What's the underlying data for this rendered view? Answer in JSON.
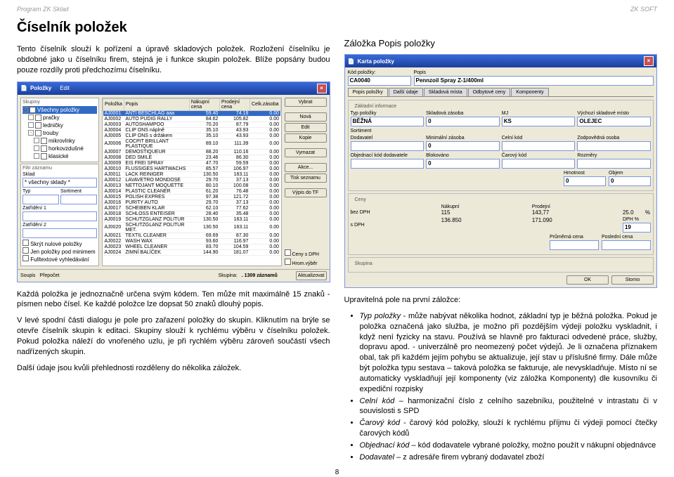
{
  "header": {
    "left": "Program ZK Sklad",
    "right": "ZK SOFT"
  },
  "left": {
    "title": "Číselník položek",
    "para1": "Tento číselník slouží k pořízení a úpravě skladových položek. Rozložení číselníku je obdobné jako u číselníku firem, stejná je i funkce skupin položek. Blíže popsány budou pouze rozdíly proti předchozímu číselníku.",
    "para2": "Každá položka je jednoznačně určena svým kódem. Ten může mít maximálně 15 znaků - písmen nebo čísel. Ke každé položce lze dopsat 50 znaků dlouhý popis.",
    "para3": "V levé spodní části dialogu je pole pro zařazení položky do skupin. Kliknutím na brýle se otevře číselník skupin k editaci. Skupiny slouží k rychlému výběru v číselníku položek. Pokud položka náleží do vnořeného uzlu, je při rychlém výběru zároveň součástí všech nadřízených skupin.",
    "para4": "Další údaje jsou kvůli přehlednosti rozděleny do několika záložek."
  },
  "right": {
    "subtitle": "Záložka Popis položky",
    "intro": "Upravitelná pole na první záložce:",
    "items": [
      "Typ položky - může nabývat několika hodnot, základní typ je běžná položka. Pokud je položka označená jako služba, je možno při pozdějším výdeji položku vyskladnit, i když není fyzicky na stavu. Používá se hlavně pro fakturaci odvedené práce, služby, dopravu apod. - univerzálně pro neomezený počet výdejů. Je li označena příznakem obal, tak při každém jejím pohybu se aktualizuje, její stav u příslušné firmy. Dále může být položka typu sestava – taková položka se fakturuje, ale nevyskladňuje. Místo ní se automaticky vyskladňují její komponenty (viz záložka Komponenty) dle kusovníku či expediční rozpisky",
      "Celní kód – harmonizační číslo z celního sazebníku, použitelné v intrastatu či v souvislosti s SPD",
      "Čarový kód - čarový kód položky, slouží k rychlému příjmu či výdeji pomocí čtečky čarových kódů",
      "Objednací kód – kód dodavatele vybrané položky, možno použít v nákupní objednávce",
      "Dodavatel – z adresáře firem vybraný dodavatel zboží"
    ]
  },
  "scr1": {
    "title": "Položky",
    "tree_head": "Skupiny",
    "tree": [
      "Všechny položky",
      "pračky",
      "ledničky",
      "trouby",
      "mikrovlnky",
      "horkovzdušné",
      "klasické"
    ],
    "filter_head": "Filtr záznamu",
    "filter_sklad_lbl": "Sklad",
    "filter_sklad_val": "* všechny sklady *",
    "f_typ": "Typ",
    "f_sort": "Sortiment",
    "f_z1": "Zatřídění 1",
    "f_z2": "Zatřídění 2",
    "chk1": "Skrýt nulové položky",
    "chk2": "Jen položky pod minimem",
    "chk3": "Fulltextové vyhledávání",
    "cols": [
      "Položka",
      "Popis",
      "Nákupní cena",
      "Prodejní cena",
      "Celk.zásoba"
    ],
    "rows": [
      [
        "AJ0001",
        "ANTI BESCHLAG aaa",
        "59.40",
        "74.18",
        "0.00"
      ],
      [
        "AJ0002",
        "AUTO PUDIG RALLY",
        "84.62",
        "105.82",
        "0.00"
      ],
      [
        "AJ0003",
        "AUTOSHAMPOO",
        "70.20",
        "87.79",
        "0.00"
      ],
      [
        "AJ0004",
        "CLIP ONS náplně",
        "35.10",
        "43.93",
        "0.00"
      ],
      [
        "AJ0005",
        "CLIP ONS s držákem",
        "35.10",
        "43.93",
        "0.00"
      ],
      [
        "AJ0006",
        "COCPIT BRILLANT PLASTIQUE",
        "89.10",
        "111.39",
        "0.00"
      ],
      [
        "AJ0007",
        "DEMOSTIQUEUR",
        "88.20",
        "110.16",
        "0.00"
      ],
      [
        "AJ0008",
        "DED SMILE",
        "23.46",
        "86.30",
        "0.00"
      ],
      [
        "AJ0009",
        "EIS FREI SPRAY",
        "47.70",
        "59.59",
        "0.00"
      ],
      [
        "AJ0010",
        "FLUSSIGES HARTWACHS",
        "85.57",
        "106.97",
        "0.00"
      ],
      [
        "AJ0011",
        "LACK REINIGER",
        "130.50",
        "163.11",
        "0.00"
      ],
      [
        "AJ0012",
        "LAVAVETRO MONDOSE",
        "29.70",
        "37.13",
        "0.00"
      ],
      [
        "AJ0013",
        "NETTOJANT MOQUETTE",
        "80.10",
        "100.08",
        "0.00"
      ],
      [
        "AJ0014",
        "PLASTIC CLEANER",
        "61.20",
        "76.48",
        "0.00"
      ],
      [
        "AJ0015",
        "POLISH EXPRES",
        "97.38",
        "121.72",
        "0.00"
      ],
      [
        "AJ0016",
        "PURITY AUTO",
        "29.70",
        "37.13",
        "0.00"
      ],
      [
        "AJ0017",
        "SCHEIBEN KLAR",
        "62.10",
        "77.62",
        "0.00"
      ],
      [
        "AJ0018",
        "SCHLOSS ENTEISER",
        "28.40",
        "35.48",
        "0.00"
      ],
      [
        "AJ0019",
        "SCHUTZGLANZ POLITUR",
        "130.50",
        "163.11",
        "0.00"
      ],
      [
        "AJ0020",
        "SCHUTZGLANZ POLITUR MET.",
        "130.50",
        "163.11",
        "0.00"
      ],
      [
        "AJ0021",
        "TEXTIL CLEANER",
        "69.69",
        "87.30",
        "0.00"
      ],
      [
        "AJ0022",
        "WASH WAX",
        "93.60",
        "116.97",
        "0.00"
      ],
      [
        "AJ0023",
        "WHEEL CLEANER",
        "83.70",
        "104.59",
        "0.00"
      ],
      [
        "AJ0024",
        "ZIMNÍ BALÍČEK",
        "144.90",
        "181.07",
        "0.00"
      ]
    ],
    "btns": [
      "Vybrat",
      "Nová",
      "Edit",
      "Kopie",
      "Vymazat",
      "Akce...",
      "Tisk seznamu",
      "Výpis do TF"
    ],
    "chkR1": "Ceny s DPH",
    "chkR2": "Hrom.výběr",
    "btnAkt": "Aktualizovat",
    "status": {
      "s1": "Soupis",
      "s2": "Přepočet",
      "s3_lbl": "Skupina:",
      "s3_val": ".   1309 záznamů",
      "menu": "Edit"
    }
  },
  "scr2": {
    "title": "Karta položky",
    "kod_lbl": "Kód položky:",
    "kod_val": "CA0040",
    "popis_lbl": "Popis",
    "popis_val": "Pennzoil Spray Z-1/400ml",
    "tabs": [
      "Popis položky",
      "Další údaje",
      "Skladová místa",
      "Odbytové ceny",
      "Komponenty"
    ],
    "grp1": "Základní informace",
    "typ_lbl": "Typ položky",
    "typ_val": "BĚŽNÁ",
    "zas_lbl": "Skladová zásoba",
    "zas_val": "0",
    "mj_lbl": "MJ",
    "mj_val": "KS",
    "vsm_lbl": "Výchozí skladové místo",
    "vsm_val": "OLEJEC",
    "sort_lbl": "Sortiment",
    "dod_lbl": "Dodavatel",
    "min_lbl": "Minimální zásoba",
    "min_val": "0",
    "cel_lbl": "Celní kód",
    "zod_lbl": "Zodpovědná osoba",
    "obk_lbl": "Objednací kód dodavatele",
    "blk_lbl": "Blokováno",
    "blk_val": "0",
    "car_lbl": "Čarový kód",
    "roz_lbl": "Rozměry",
    "hmo_lbl": "Hmotnost",
    "hmo_val": "0",
    "obj_lbl": "Objem",
    "obj_val": "0",
    "grp2": "Ceny",
    "nak_lbl": "Nákupní",
    "pro_lbl": "Prodejní",
    "bez_lbl": "bez DPH",
    "bez_n": "115",
    "bez_p": "143,77",
    "marz": "25.0",
    "pc": "%",
    "s_lbl": "s DPH",
    "s_n": "136.850",
    "s_p": "171.090",
    "dph_lbl": "DPH %",
    "dph_val": "19",
    "prc_lbl": "Průměrná cena",
    "posc_lbl": "Poslední cena",
    "grp3": "Skupina",
    "ok": "OK",
    "storno": "Storno"
  },
  "pagenum": "8"
}
